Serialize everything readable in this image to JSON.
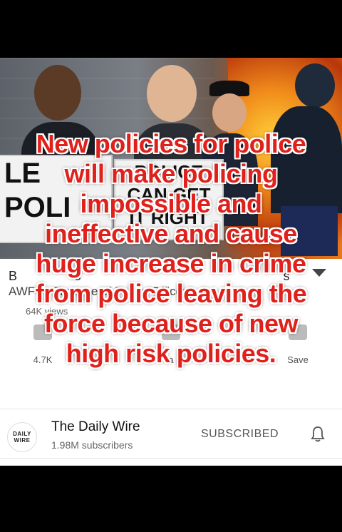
{
  "thumbnail": {
    "sign_left_lines": [
      "LE",
      "POLI"
    ],
    "sign_center_lines": [
      "POLICE",
      "CAN GET",
      "IT RIGHT"
    ]
  },
  "video": {
    "title_line1": "B",
    "title_line1_suffix": "o",
    "title_line1_tail": "'s",
    "title_line2": "AWFUL Treatme   of Police Officers",
    "views": "64K views",
    "likes": "4.7K",
    "share_fragment": "a",
    "save_label": "Save"
  },
  "channel": {
    "avatar_line1": "DAILY",
    "avatar_line2": "WIRE",
    "name": "The Daily Wire",
    "subscribers": "1.98M subscribers",
    "subscribe_state": "SUBSCRIBED",
    "bell_icon": "bell-icon"
  },
  "caption": {
    "lines": [
      "New policies for police",
      "will make policing",
      "impossible and",
      "ineffective and cause",
      "huge increase in crime",
      "from police leaving the",
      "force because of new",
      "high risk policies."
    ]
  },
  "colors": {
    "caption_fill": "#e0201b",
    "caption_outline": "#ffffff",
    "background": "#000000"
  }
}
